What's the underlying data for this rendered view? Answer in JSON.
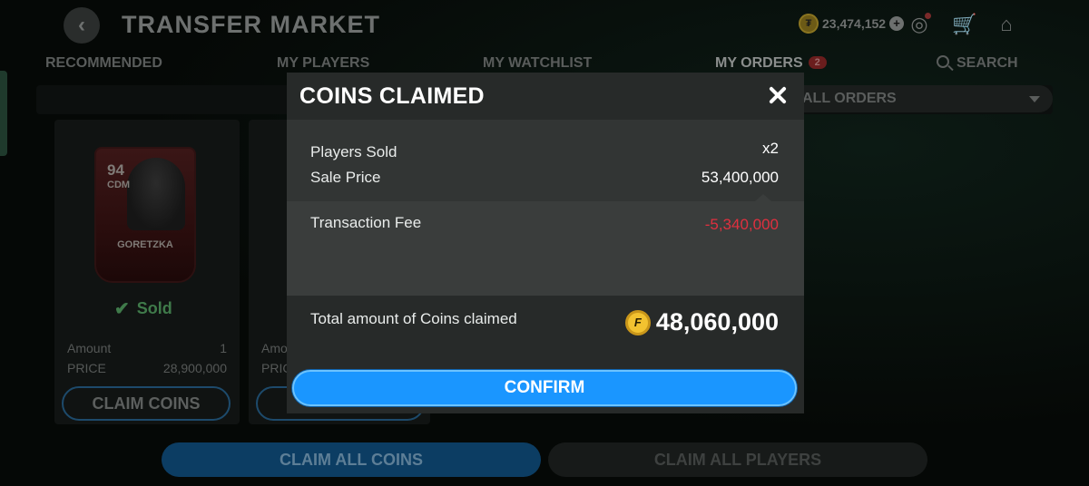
{
  "header": {
    "title": "TRANSFER MARKET",
    "coins": "23,474,152"
  },
  "tabs": [
    {
      "label": "RECOMMENDED"
    },
    {
      "label": "MY PLAYERS"
    },
    {
      "label": "MY WATCHLIST"
    },
    {
      "label": "MY ORDERS",
      "badge": "2"
    },
    {
      "label": "SEARCH"
    }
  ],
  "filter": {
    "selected": "ALL ORDERS"
  },
  "orders": [
    {
      "player_rating": "94",
      "player_position": "CDM",
      "player_name": "GORETZKA",
      "status": "Sold",
      "amount_label": "Amount",
      "amount": "1",
      "price_label": "PRICE",
      "price": "28,900,000",
      "claim_label": "CLAIM COINS"
    },
    {
      "amount_label": "Amo",
      "price_label": "PRIC"
    }
  ],
  "bottom": {
    "claim_all_coins": "CLAIM ALL COINS",
    "claim_all_players": "CLAIM ALL PLAYERS"
  },
  "modal": {
    "title": "COINS CLAIMED",
    "players_sold_label": "Players Sold",
    "players_sold_value": "x2",
    "sale_price_label": "Sale Price",
    "sale_price_value": "53,400,000",
    "fee_label": "Transaction Fee",
    "fee_value": "-5,340,000",
    "total_label": "Total amount of Coins claimed",
    "total_value": "48,060,000",
    "confirm_label": "CONFIRM"
  },
  "colors": {
    "accent_blue": "#1a96ff",
    "fee_red": "#e0303f",
    "coin_gold": "#f2c230",
    "sold_green": "#3f7a4a"
  }
}
